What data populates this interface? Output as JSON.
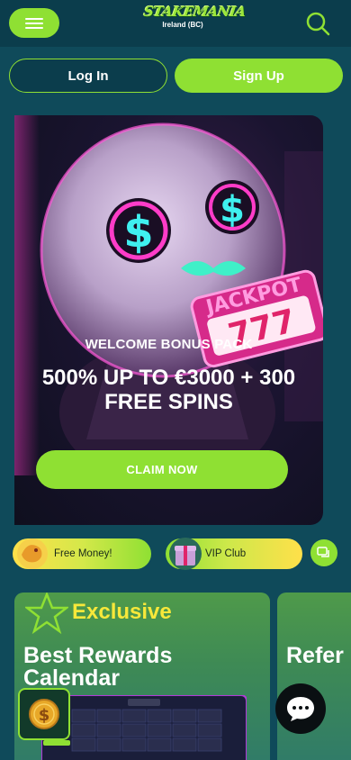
{
  "header": {
    "logo_text": "STAKEMANIA",
    "logo_subtitle": "Ireland (BC)",
    "menu_icon": "hamburger-icon",
    "search_icon": "search-icon"
  },
  "auth": {
    "login_label": "Log In",
    "signup_label": "Sign Up"
  },
  "hero": {
    "eyebrow": "WELCOME BONUS PACK",
    "title": "500% UP TO €3000 + 300 FREE SPINS",
    "cta_label": "CLAIM NOW",
    "art_text": "JACKPOT",
    "reels": "777"
  },
  "promos": [
    {
      "label": "Free Money!",
      "icon": "dragon-icon"
    },
    {
      "label": "VIP Club",
      "icon": "gift-icon"
    }
  ],
  "cards": [
    {
      "badge": "Exclusive",
      "title": "Best Rewards Calendar"
    },
    {
      "title": "Refer Program"
    }
  ],
  "colors": {
    "accent": "#8fe033",
    "background": "#0f4a5a",
    "header": "#0b3d4c",
    "badge_yellow": "#f7e83a"
  }
}
